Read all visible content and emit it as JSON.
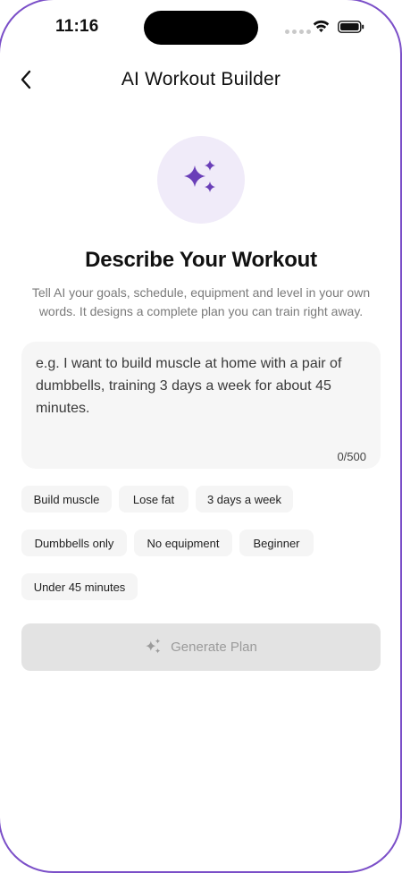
{
  "status_bar": {
    "time": "11:16"
  },
  "header": {
    "title": "AI Workout Builder",
    "back_icon": "chevron-left-icon"
  },
  "hero": {
    "icon": "sparkles-icon",
    "headline": "Describe Your Workout",
    "description": "Tell AI your goals, schedule, equipment and level in your own words. It designs a complete plan you can train right away."
  },
  "prompt": {
    "value": "",
    "placeholder": "e.g. I want to build muscle at home with a pair of dumbbells, training 3 days a week for about 45 minutes.",
    "char_count": "0/500"
  },
  "suggestions": [
    {
      "label": "Build muscle"
    },
    {
      "label": "Lose fat"
    },
    {
      "label": "3 days a week"
    },
    {
      "label": "Dumbbells only"
    },
    {
      "label": "No equipment"
    },
    {
      "label": "Beginner"
    },
    {
      "label": "Under 45 minutes"
    }
  ],
  "generate_button": {
    "label": "Generate Plan",
    "icon": "sparkles-icon",
    "enabled": false
  },
  "colors": {
    "accent": "#6a3fb8",
    "hero_bg": "#f0ebf9",
    "disabled_bg": "#e3e3e3",
    "disabled_text": "#9b9b9b"
  }
}
